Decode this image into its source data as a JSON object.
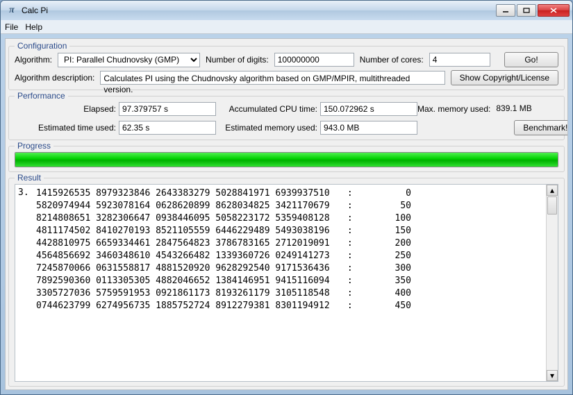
{
  "window": {
    "title": "Calc Pi",
    "icon_glyph": "π"
  },
  "menu": {
    "file": "File",
    "help": "Help"
  },
  "config": {
    "legend": "Configuration",
    "algorithm_label": "Algorithm:",
    "algorithm_value": "PI: Parallel Chudnovsky (GMP)",
    "digits_label": "Number of digits:",
    "digits_value": "100000000",
    "cores_label": "Number of cores:",
    "cores_value": "4",
    "go": "Go!",
    "desc_label": "Algorithm description:",
    "desc_value": "Calculates PI using the Chudnovsky algorithm based on GMP/MPIR, multithreaded version.",
    "copyright": "Show Copyright/License"
  },
  "perf": {
    "legend": "Performance",
    "elapsed_label": "Elapsed:",
    "elapsed_value": "97.379757 s",
    "cpu_label": "Accumulated CPU time:",
    "cpu_value": "150.072962 s",
    "mem_label": "Max. memory used:",
    "mem_value": "839.1 MB",
    "est_time_label": "Estimated time used:",
    "est_time_value": "62.35 s",
    "est_mem_label": "Estimated memory used:",
    "est_mem_value": "943.0 MB",
    "benchmark": "Benchmark!"
  },
  "progress": {
    "legend": "Progress",
    "percent": 100
  },
  "result": {
    "legend": "Result",
    "prefix": "3.",
    "lines": [
      {
        "digits": "1415926535 8979323846 2643383279 5028841971 6939937510",
        "idx": "0"
      },
      {
        "digits": "5820974944 5923078164 0628620899 8628034825 3421170679",
        "idx": "50"
      },
      {
        "digits": "8214808651 3282306647 0938446095 5058223172 5359408128",
        "idx": "100"
      },
      {
        "digits": "4811174502 8410270193 8521105559 6446229489 5493038196",
        "idx": "150"
      },
      {
        "digits": "4428810975 6659334461 2847564823 3786783165 2712019091",
        "idx": "200"
      },
      {
        "digits": "4564856692 3460348610 4543266482 1339360726 0249141273",
        "idx": "250"
      },
      {
        "digits": "7245870066 0631558817 4881520920 9628292540 9171536436",
        "idx": "300"
      },
      {
        "digits": "7892590360 0113305305 4882046652 1384146951 9415116094",
        "idx": "350"
      },
      {
        "digits": "3305727036 5759591953 0921861173 8193261179 3105118548",
        "idx": "400"
      },
      {
        "digits": "0744623799 6274956735 1885752724 8912279381 8301194912",
        "idx": "450"
      }
    ]
  }
}
